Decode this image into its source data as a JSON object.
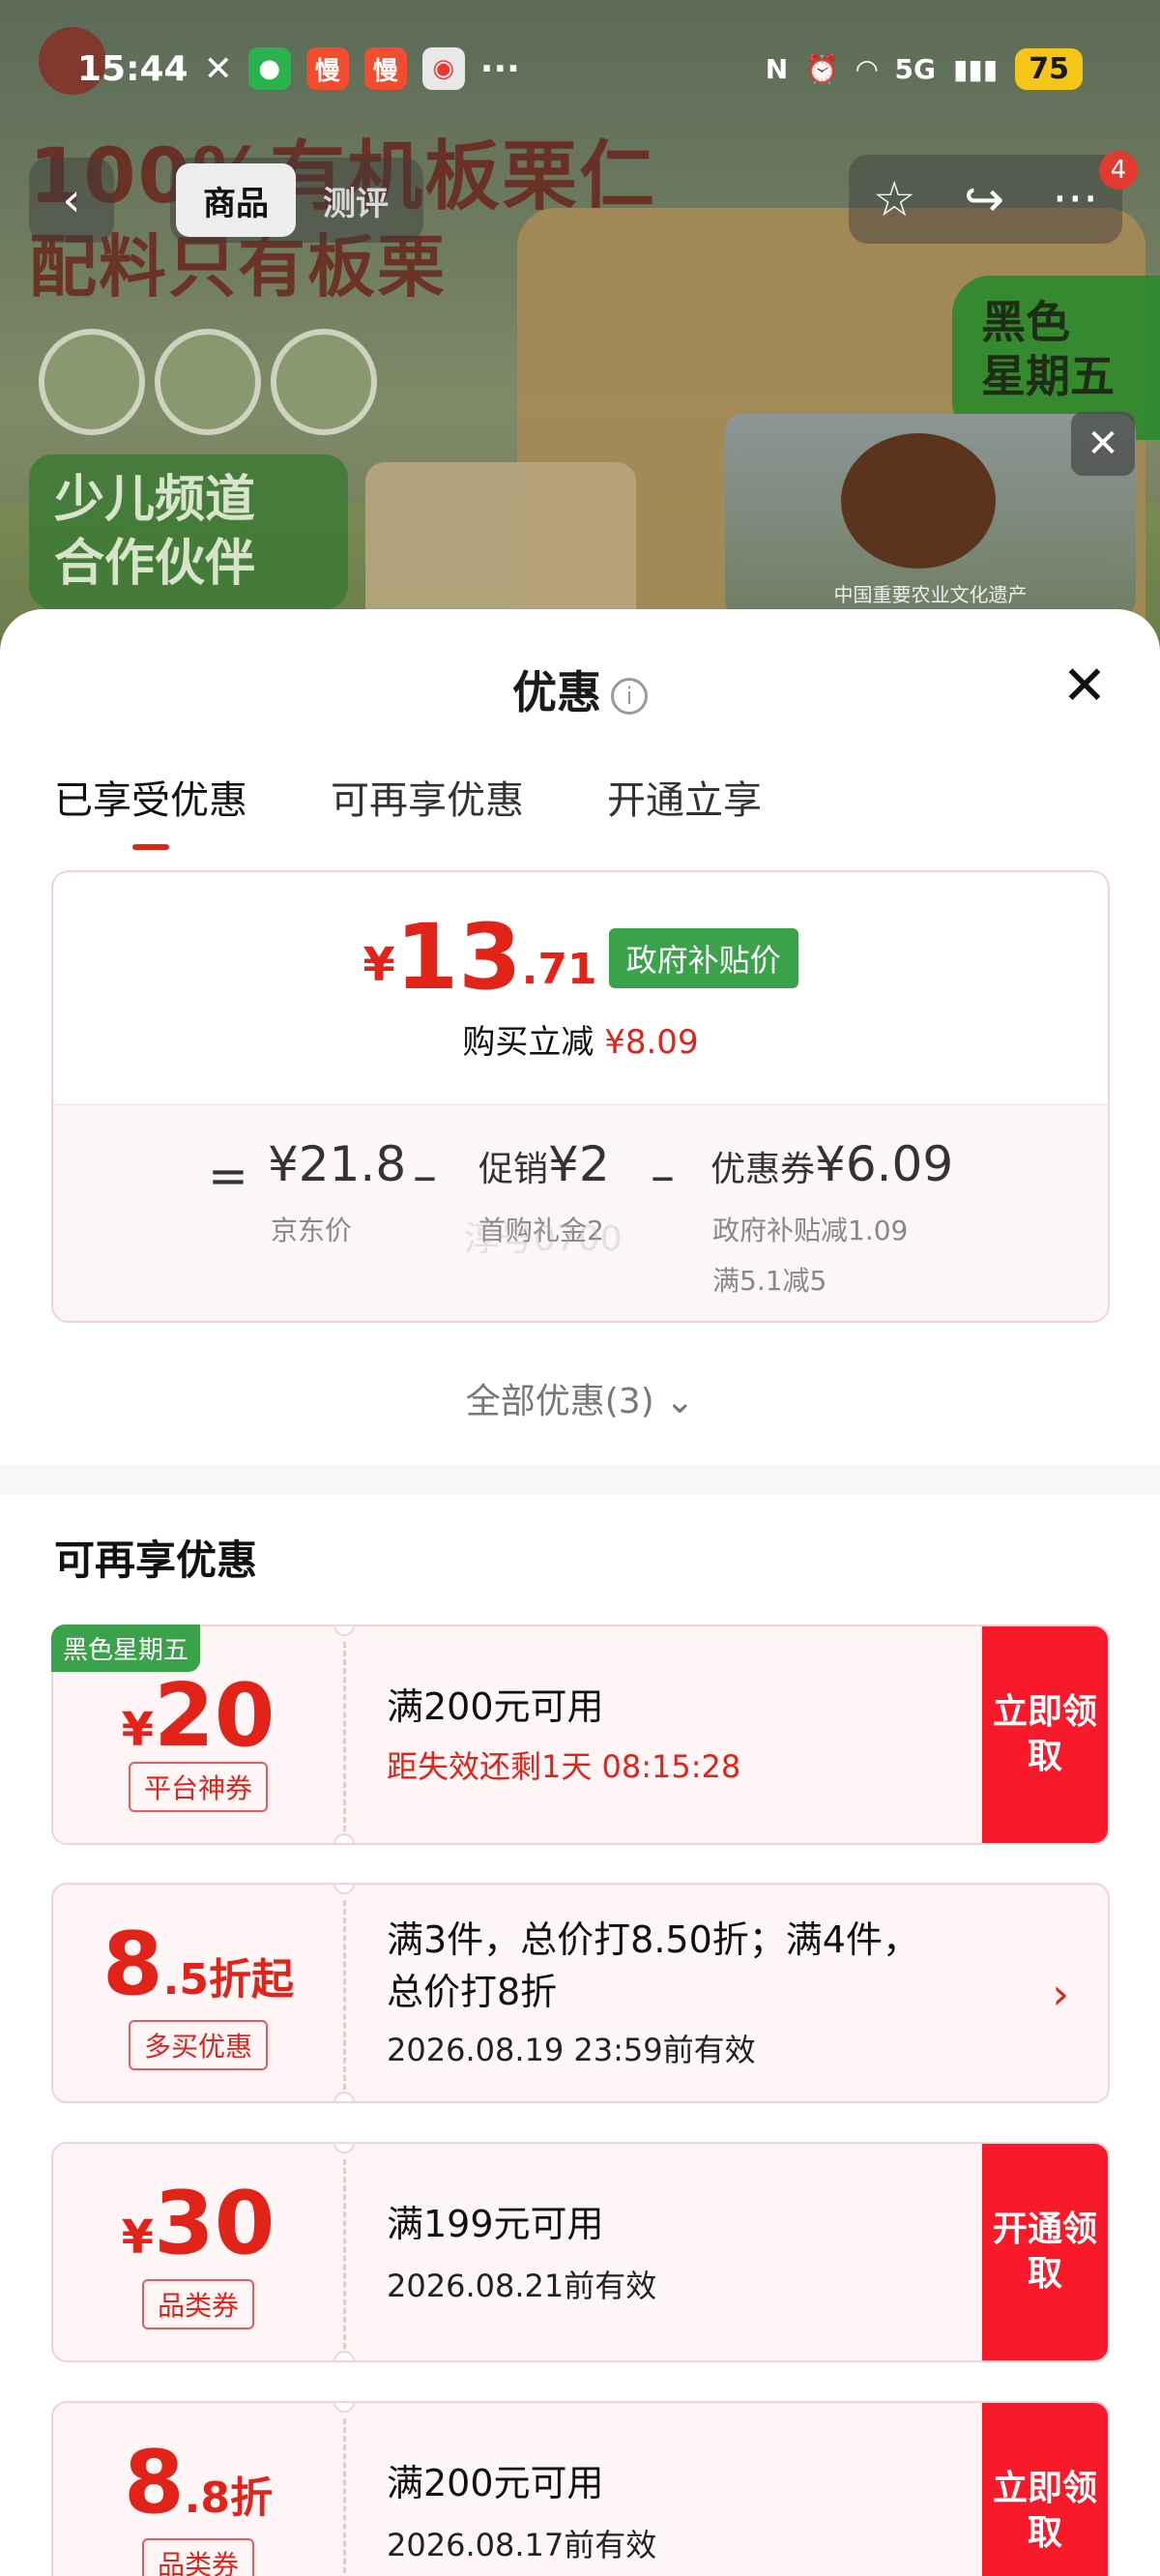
{
  "status_bar": {
    "time": "15:44",
    "network": "5G",
    "battery": "75"
  },
  "banner": {
    "headline_1": "100%有机板栗仁",
    "headline_2": "配料只有板栗",
    "kids_line_1": "少儿频道",
    "kids_line_2": "合作伙伴",
    "black_friday_1": "黑色",
    "black_friday_2": "星期五",
    "video_caption": "中国重要农业文化遗产"
  },
  "page_nav": {
    "tabs": [
      "商品",
      "测评"
    ],
    "active_tab": 0,
    "notification_count": "4"
  },
  "sheet": {
    "title": "优惠",
    "tabs": [
      "已享受优惠",
      "可再享优惠",
      "开通立享"
    ],
    "active_tab": 0
  },
  "summary": {
    "price_yen": "¥",
    "price_int": "13",
    "price_dec": ".71",
    "price_tag": "政府补贴价",
    "reduce_label": "购买立减",
    "reduce_value": "¥8.09",
    "eq_sign": "=",
    "minus": "–",
    "jd_price": "¥21.8",
    "jd_price_label": "京东价",
    "promo_label": "促销",
    "promo_value": "¥2",
    "promo_sub": "首购礼金2",
    "coupon_label": "优惠券",
    "coupon_value": "¥6.09",
    "coupon_sub_1": "政府补贴减1.09",
    "coupon_sub_2": "满5.1减5"
  },
  "all_offers": "全部优惠(3)",
  "section_title": "可再享优惠",
  "coupons": [
    {
      "corner_tag": "黑色星期五",
      "currency": "¥",
      "amount": "20",
      "type": "平台神券",
      "desc": "满200元可用",
      "sub": "距失效还剩1天 08:15:28",
      "action": "立即领取"
    },
    {
      "amount_big": "8",
      "amount_small": ".5折起",
      "type": "多买优惠",
      "desc_1": "满3件，总价打8.50折；满4件，",
      "desc_2": "总价打8折",
      "sub": "2026.08.19 23:59前有效"
    },
    {
      "currency": "¥",
      "amount": "30",
      "type": "品类券",
      "desc": "满199元可用",
      "sub": "2026.08.21前有效",
      "action": "开通领取"
    },
    {
      "amount_big": "8",
      "amount_small": ".8折",
      "type": "品类券",
      "desc": "满200元可用",
      "sub": "2026.08.17前有效",
      "action": "立即领取"
    }
  ],
  "watermark": "淳号0700",
  "colors": {
    "accent_red": "#e2231a",
    "claim_red": "#f81a2a",
    "gov_green": "#3aa24a"
  }
}
